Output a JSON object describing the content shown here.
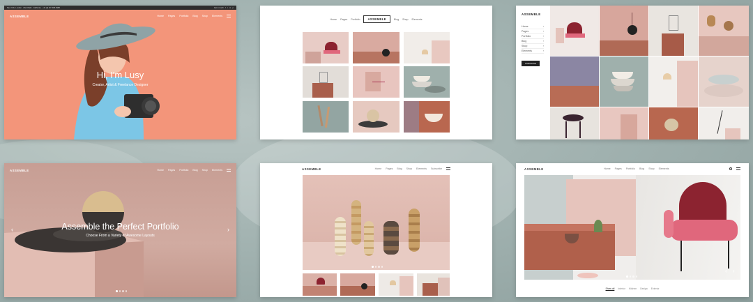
{
  "card1": {
    "topbar": "New York, London · Abu Dhabi · California · +44 (0) 20 7946 0958",
    "topbar_right": "Get in touch · f · t · in · p",
    "logo": "ASSEMBLE",
    "nav": [
      "Home",
      "Pages",
      "Portfolio",
      "Blog",
      "Shop",
      "Elements"
    ],
    "title": "Hi, I'm Lusy",
    "subtitle": "Creator, Artist & Freelance Designer"
  },
  "card2": {
    "nav_left": [
      "Home",
      "Pages",
      "Portfolio"
    ],
    "logo": "ASSEMBLE",
    "nav_right": [
      "Blog",
      "Shop",
      "Elements"
    ]
  },
  "card3": {
    "logo": "ASSEMBLE",
    "menu": [
      "Home",
      "Pages",
      "Portfolio",
      "Blog",
      "Shop",
      "Elements"
    ],
    "button": "PURCHASE"
  },
  "card4": {
    "logo": "ASSEMBLE",
    "nav": [
      "Home",
      "Pages",
      "Portfolio",
      "Blog",
      "Shop",
      "Elements"
    ],
    "title": "Assemble the Perfect Portfolio",
    "subtitle": "Choose From a Variety of Awesome Layouts"
  },
  "card5": {
    "logo": "ASSEMBLE",
    "nav": [
      "Home",
      "Pages",
      "Blog",
      "Shop",
      "Elements",
      "Subscribe"
    ]
  },
  "card6": {
    "logo": "ASSEMBLE",
    "nav": [
      "Home",
      "Pages",
      "Portfolio",
      "Blog",
      "Shop",
      "Elements"
    ],
    "filters": [
      "Show all",
      "Interior",
      "Kitchen",
      "Design",
      "Exterior"
    ]
  },
  "colors": {
    "accent_salmon": "#f08a6a",
    "mauve": "#c9a49a",
    "terracotta": "#b4634e",
    "sage": "#93a5a2",
    "pink_chair": "#e0677c",
    "dark": "#2b2b2b"
  }
}
